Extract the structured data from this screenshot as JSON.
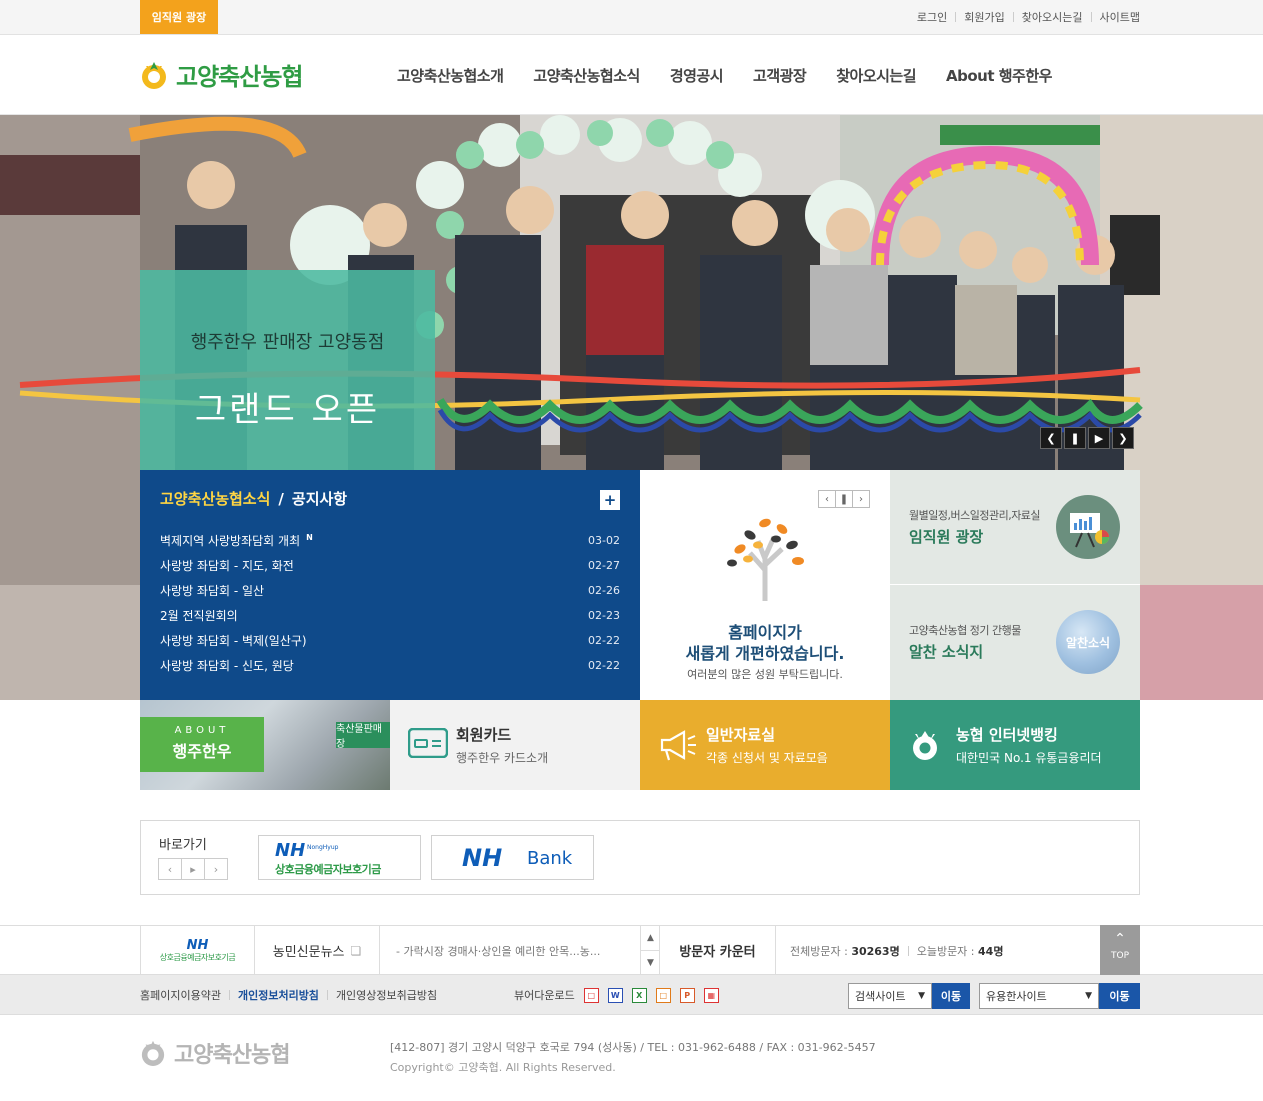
{
  "topbar": {
    "staff_tab": "임직원 광장",
    "links": [
      "로그인",
      "회원가입",
      "찾아오시는길",
      "사이트맵"
    ]
  },
  "header": {
    "logo_text": "고양축산농협",
    "nav": [
      "고양축산농협소개",
      "고양축산농협소식",
      "경영공시",
      "고객광장",
      "찾아오시는길",
      "About 행주한우"
    ]
  },
  "hero": {
    "caption_line1": "행주한우 판매장 고양동점",
    "caption_line2": "그랜드 오픈"
  },
  "notice": {
    "tab_active": "고양축산농협소식",
    "tab_other": "공지사항",
    "more": "+",
    "new_badge": "N",
    "items": [
      {
        "title": "벽제지역 사랑방좌담회 개최",
        "date": "03-02",
        "new": true
      },
      {
        "title": "사랑방 좌담회 - 지도, 화전",
        "date": "02-27",
        "new": false
      },
      {
        "title": "사랑방 좌담회 - 일산",
        "date": "02-26",
        "new": false
      },
      {
        "title": "2월 전직원회의",
        "date": "02-23",
        "new": false
      },
      {
        "title": "사랑방 좌담회 - 벽제(일산구)",
        "date": "02-22",
        "new": false
      },
      {
        "title": "사랑방 좌담회 - 신도, 원당",
        "date": "02-22",
        "new": false
      }
    ]
  },
  "renewal": {
    "heading_line1": "홈페이지가",
    "heading_line2": "새롭게 개편하였습니다.",
    "sub": "여러분의 많은 성원 부탁드립니다."
  },
  "side": {
    "plaza_sub": "월별일정,버스일정관리,자료실",
    "plaza_title": "임직원 광장",
    "letter_sub": "고양축산농협 정기 간행물",
    "letter_title": "알찬 소식지",
    "letter_icon_text": "알찬소식"
  },
  "quick": {
    "about_en": "ABOUT",
    "about_ko": "행주한우",
    "about_sign": "축산물판매장",
    "card_title": "회원카드",
    "card_sub": "행주한우 카드소개",
    "data_title": "일반자료실",
    "data_sub": "각종 신청서 및 자료모음",
    "bank_title": "농협 인터넷뱅킹",
    "bank_sub": "대한민국 No.1 유통금융리더"
  },
  "shortcut": {
    "label": "바로가기",
    "banner1_nh": "NH",
    "banner1_small": "NongHyup",
    "banner1_text": "상호금융예금자보호기금",
    "banner2_nh": "NH",
    "banner2_bank": "Bank"
  },
  "strip1": {
    "logo_nh": "NH",
    "logo_text": "상호금융예금자보호기금",
    "news_label": "농민신문뉴스",
    "ticker": "- 가락시장 경매사·상인을 예리한 안목...농...",
    "visitor_label": "방문자 카운터",
    "total_label": "전체방문자 :",
    "total_value": "30263명",
    "today_label": "오늘방문자 :",
    "today_value": "44명",
    "top_label": "TOP"
  },
  "strip2": {
    "links": [
      "홈페이지이용약관",
      "개인정보처리방침",
      "개인영상정보취급방침"
    ],
    "viewer_label": "뷰어다운로드",
    "viewer_icons": [
      "pdf-icon",
      "word-icon",
      "excel-icon",
      "hwp-icon",
      "ppt-icon",
      "image-icon"
    ],
    "select1": "검색사이트",
    "select2": "유용한사이트",
    "go": "이동"
  },
  "footer": {
    "logo_text": "고양축산농협",
    "address": "[412-807] 경기 고양시 덕양구 호국로 794 (성사동) / TEL : 031-962-6488 / FAX : 031-962-5457",
    "copyright": "Copyright© 고양축협. All Rights Reserved."
  },
  "colors": {
    "brand_green": "#2f9c44",
    "accent_orange": "#f3a21c",
    "notice_blue": "#0f4a8a",
    "data_yellow": "#e9ad2d",
    "bank_teal": "#359a7e"
  }
}
